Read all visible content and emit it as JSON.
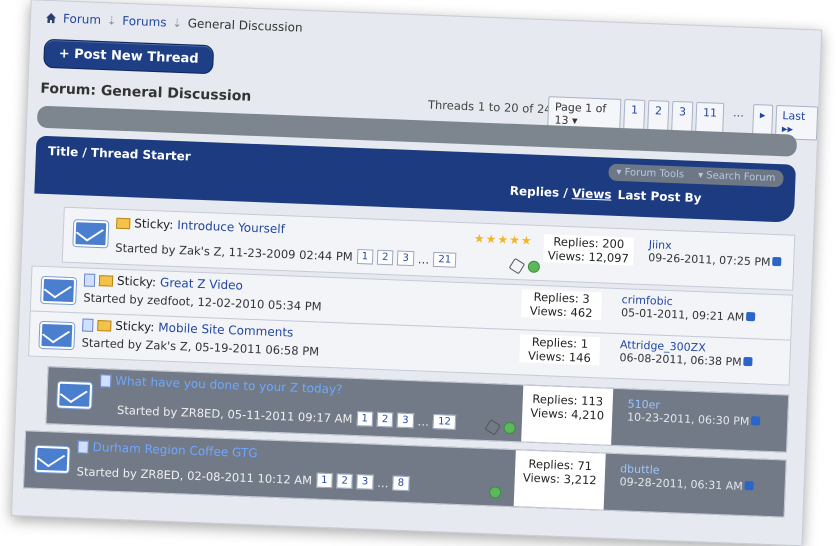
{
  "breadcrumb": {
    "home_icon": "home-icon",
    "items": [
      "Forum",
      "Forums",
      "General Discussion"
    ]
  },
  "post_button": "+ Post New Thread",
  "forum_title": "Forum: General Discussion",
  "threads_count": "Threads 1 to 20 of 247",
  "pager": {
    "page_of": "Page 1 of 13",
    "pages": [
      "1",
      "2",
      "3",
      "11",
      "…"
    ],
    "next": "▸",
    "last": "Last ▸▸"
  },
  "header": {
    "title": "Title / Thread Starter",
    "forum_tools": "Forum Tools",
    "search_forum": "Search Forum",
    "replies": "Replies",
    "views": "Views",
    "last_post_by": "Last Post By"
  },
  "threads": [
    {
      "prefix": "Sticky:",
      "title": "Introduce Yourself",
      "starter": "Started by Zak's Z, 11-23-2009 02:44 PM",
      "pages": [
        "1",
        "2",
        "3",
        "…",
        "21"
      ],
      "replies": "Replies: 200",
      "views": "Views: 12,097",
      "last_user": "Jiinx",
      "last_date": "09-26-2011, 07:25 PM",
      "rating_stars": 5
    },
    {
      "prefix": "Sticky:",
      "title": "Great Z Video",
      "starter": "Started by zedfoot, 12-02-2010 05:34 PM",
      "pages": [],
      "replies": "Replies: 3",
      "views": "Views: 462",
      "last_user": "crimfobic",
      "last_date": "05-01-2011, 09:21 AM"
    },
    {
      "prefix": "Sticky:",
      "title": "Mobile Site Comments",
      "starter": "Started by Zak's Z, 05-19-2011 06:58 PM",
      "pages": [],
      "replies": "Replies: 1",
      "views": "Views: 146",
      "last_user": "Attridge_300ZX",
      "last_date": "06-08-2011, 06:38 PM"
    },
    {
      "prefix": "",
      "title": "What have you done to your Z today?",
      "starter": "Started by ZR8ED, 05-11-2011 09:17 AM",
      "pages": [
        "1",
        "2",
        "3",
        "…",
        "12"
      ],
      "replies": "Replies: 113",
      "views": "Views: 4,210",
      "last_user": "510er",
      "last_date": "10-23-2011, 06:30 PM"
    },
    {
      "prefix": "",
      "title": "Durham Region Coffee GTG",
      "starter": "Started by ZR8ED, 02-08-2011 10:12 AM",
      "pages": [
        "1",
        "2",
        "3",
        "…",
        "8"
      ],
      "replies": "Replies: 71",
      "views": "Views: 3,212",
      "last_user": "dbuttle",
      "last_date": "09-28-2011, 06:31 AM"
    }
  ]
}
